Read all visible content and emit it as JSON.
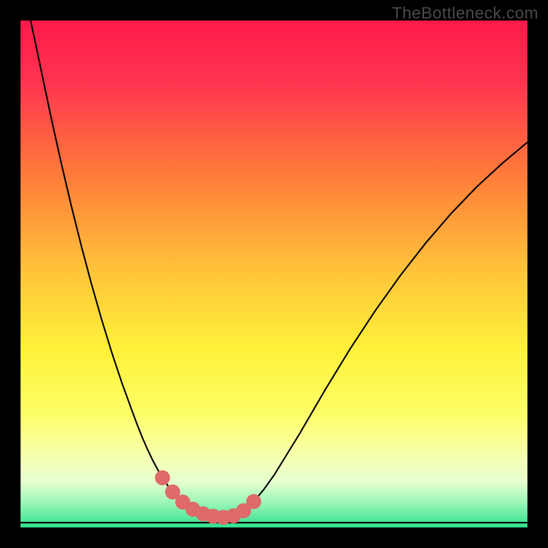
{
  "watermark": "TheBottleneck.com",
  "colors": {
    "curve": "#000000",
    "marker": "#de6a6a",
    "baseline": "#32d98c",
    "frame": "#000000"
  },
  "chart_data": {
    "type": "line",
    "title": "",
    "xlabel": "",
    "ylabel": "",
    "xlim": [
      0,
      100
    ],
    "ylim": [
      0,
      100
    ],
    "x": [
      0,
      2,
      4,
      6,
      8,
      10,
      12,
      14,
      16,
      18,
      20,
      22,
      23,
      24,
      25,
      26,
      27,
      28,
      29,
      30,
      31,
      32,
      33,
      34,
      35,
      36,
      38,
      40,
      42,
      44,
      46,
      48,
      50,
      55,
      60,
      65,
      70,
      75,
      80,
      85,
      90,
      95,
      100
    ],
    "values": [
      110,
      100,
      90.5,
      81,
      72,
      63.5,
      55.5,
      48,
      41,
      34.5,
      28.5,
      23,
      20.3,
      17.8,
      15.5,
      13.4,
      11.5,
      9.8,
      8.3,
      7,
      5.9,
      5,
      4.2,
      3.6,
      3.1,
      2.7,
      2.2,
      2,
      2.3,
      3.3,
      5.1,
      7.5,
      10.3,
      18.4,
      27,
      35.2,
      42.8,
      49.8,
      56.2,
      62,
      67.2,
      71.8,
      76
    ],
    "series": [
      {
        "name": "bottleneck-curve",
        "x": [
          0,
          2,
          4,
          6,
          8,
          10,
          12,
          14,
          16,
          18,
          20,
          22,
          23,
          24,
          25,
          26,
          27,
          28,
          29,
          30,
          31,
          32,
          33,
          34,
          35,
          36,
          38,
          40,
          42,
          44,
          46,
          48,
          50,
          55,
          60,
          65,
          70,
          75,
          80,
          85,
          90,
          95,
          100
        ],
        "values": [
          110,
          100,
          90.5,
          81,
          72,
          63.5,
          55.5,
          48,
          41,
          34.5,
          28.5,
          23,
          20.3,
          17.8,
          15.5,
          13.4,
          11.5,
          9.8,
          8.3,
          7,
          5.9,
          5,
          4.2,
          3.6,
          3.1,
          2.7,
          2.2,
          2,
          2.3,
          3.3,
          5.1,
          7.5,
          10.3,
          18.4,
          27,
          35.2,
          42.8,
          49.8,
          56.2,
          62,
          67.2,
          71.8,
          76
        ]
      }
    ],
    "markers": {
      "name": "highlight-points",
      "x": [
        28,
        30,
        32,
        34,
        36,
        38,
        40,
        42,
        44,
        46
      ],
      "values": [
        9.8,
        7,
        5,
        3.6,
        2.7,
        2.2,
        2,
        2.3,
        3.3,
        5.1
      ]
    }
  }
}
